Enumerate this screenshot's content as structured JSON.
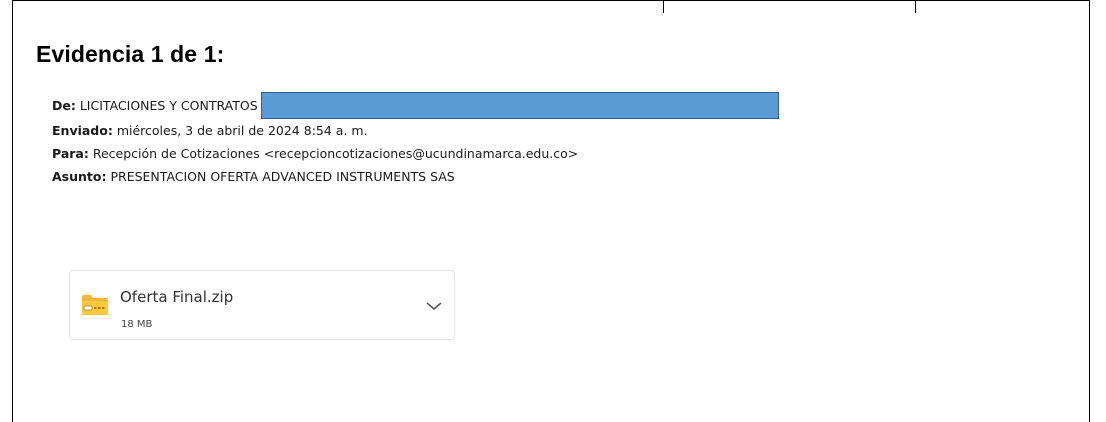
{
  "evidence": {
    "title": "Evidencia 1 de 1:"
  },
  "email": {
    "from_label": "De:",
    "from_value": "LICITACIONES Y CONTRATOS",
    "sent_label": "Enviado:",
    "sent_value": "miércoles, 3 de abril de 2024 8:54 a. m.",
    "to_label": "Para:",
    "to_value": "Recepción de Cotizaciones <recepcioncotizaciones@ucundinamarca.edu.co>",
    "subject_label": "Asunto:",
    "subject_value": "PRESENTACION OFERTA ADVANCED INSTRUMENTS SAS",
    "redaction_color": "#5b9bd5"
  },
  "attachment": {
    "name": "Oferta Final.zip",
    "size": "18 MB",
    "icon": "zip-folder-icon",
    "expand_icon": "chevron-down-icon"
  }
}
